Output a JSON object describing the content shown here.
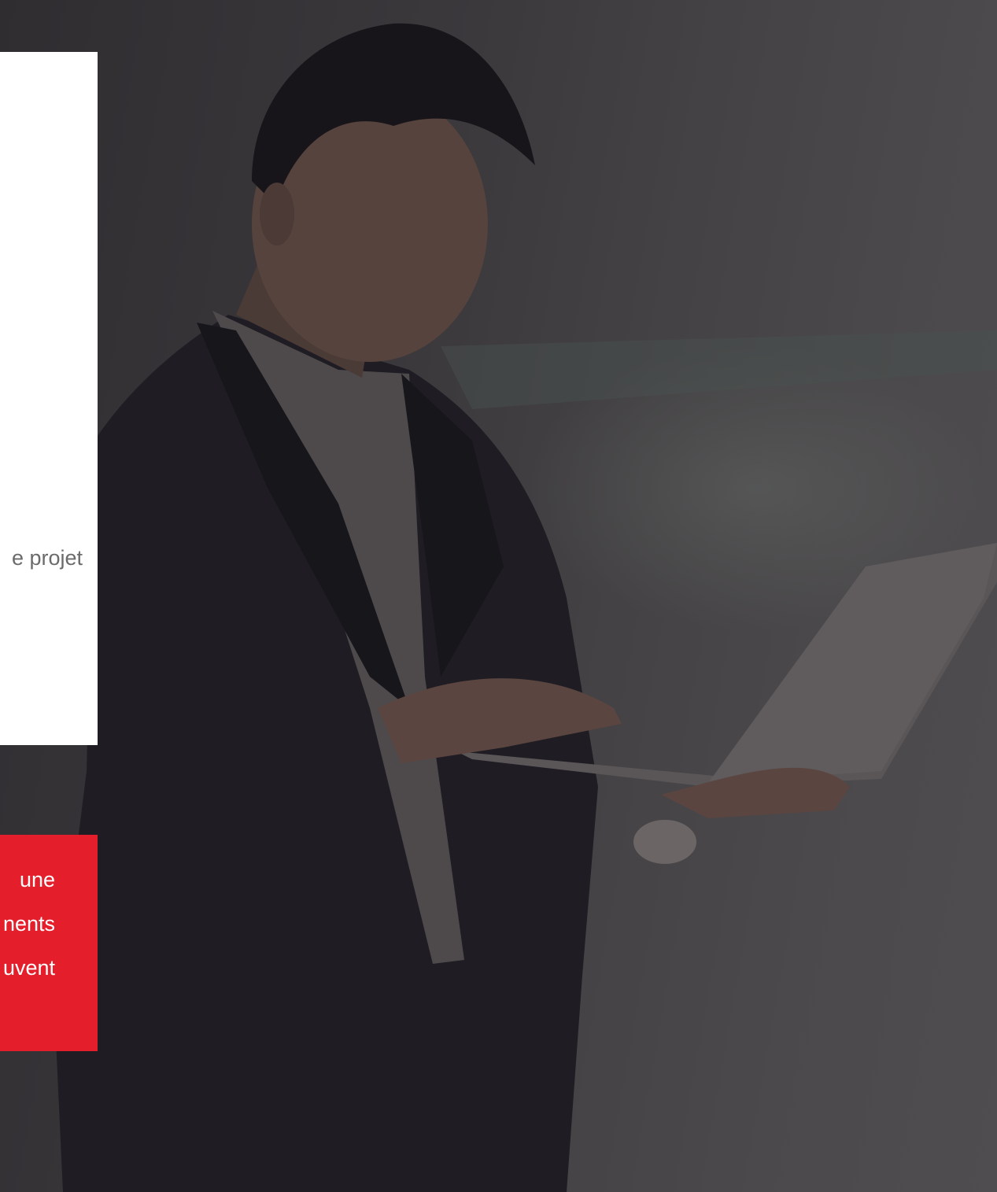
{
  "hero": {
    "image_subject": "businessman-with-laptop"
  },
  "white_card": {
    "text": "e projet"
  },
  "red_card": {
    "lines": [
      "une",
      "nents",
      "uvent"
    ]
  },
  "colors": {
    "accent_red": "#e41e2b",
    "card_white": "#ffffff",
    "overlay_dark": "#3a3739",
    "muted_text": "#6b6b6b"
  }
}
